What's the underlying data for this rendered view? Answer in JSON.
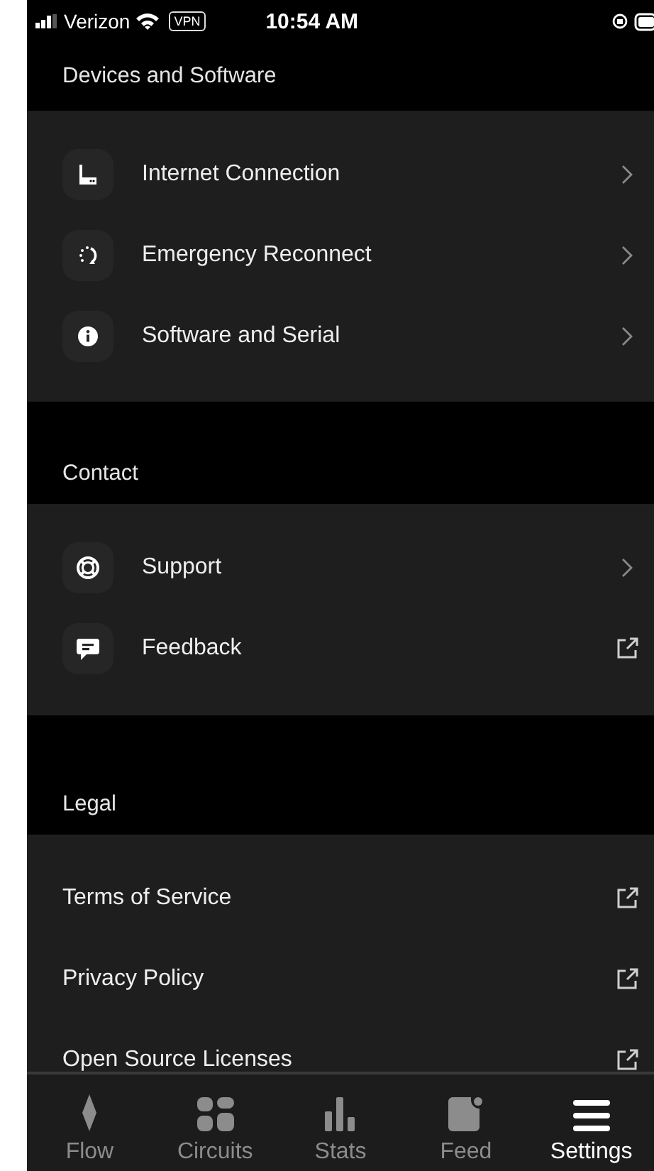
{
  "status_bar": {
    "carrier": "Verizon",
    "vpn": "VPN",
    "time": "10:54 AM"
  },
  "sections": [
    {
      "title": "Devices and Software",
      "rows": [
        {
          "kind": "icon-row",
          "label": "Internet Connection",
          "external": false
        },
        {
          "kind": "icon-row",
          "label": "Emergency Reconnect",
          "external": false
        },
        {
          "kind": "icon-row",
          "label": "Software and Serial",
          "external": false
        }
      ]
    },
    {
      "title": "Contact",
      "rows": [
        {
          "kind": "icon-row",
          "label": "Support",
          "external": false
        },
        {
          "kind": "icon-row",
          "label": "Feedback",
          "external": true
        }
      ]
    },
    {
      "title": "Legal",
      "rows": [
        {
          "kind": "plain-row",
          "label": "Terms of Service",
          "external": true
        },
        {
          "kind": "plain-row",
          "label": "Privacy Policy",
          "external": true
        },
        {
          "kind": "plain-row",
          "label": "Open Source Licenses",
          "external": true
        }
      ]
    }
  ],
  "tab_bar": [
    {
      "label": "Flow",
      "selected": false
    },
    {
      "label": "Circuits",
      "selected": false
    },
    {
      "label": "Stats",
      "selected": false
    },
    {
      "label": "Feed",
      "selected": false
    },
    {
      "label": "Settings",
      "selected": true
    }
  ]
}
